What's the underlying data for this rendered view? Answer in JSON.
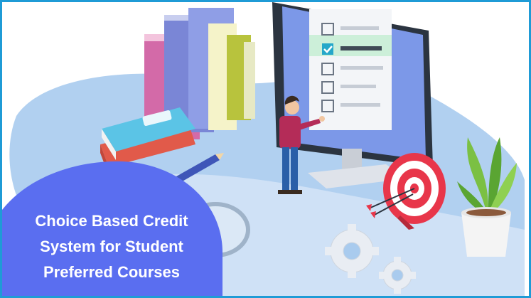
{
  "banner": {
    "title_lines": [
      "Choice Based Credit",
      "System for Student",
      "Preferred Courses"
    ]
  },
  "colors": {
    "border": "#1f9bd6",
    "caption_circle": "#5a6ef0",
    "floor_blob": "#a9cbee",
    "monitor_frame": "#2b3440",
    "monitor_screen": "#7c98e8",
    "target_red": "#e8364a",
    "plant_green": "#7bc043"
  },
  "icons": [
    "books-stack",
    "monitor",
    "checklist",
    "person",
    "pencil",
    "magnifier",
    "target",
    "arrows",
    "gear-icon",
    "plant"
  ]
}
